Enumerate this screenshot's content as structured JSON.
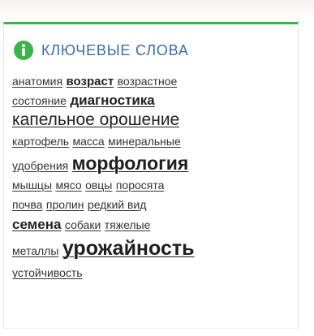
{
  "widget": {
    "title": "КЛЮЧЕВЫЕ СЛОВА",
    "icon": "info-icon",
    "accent_color": "#3bb44a",
    "title_color": "#3b6ea5"
  },
  "tags": [
    {
      "text": "анатомия"
    },
    {
      "text": "возраст"
    },
    {
      "text": "возрастное"
    },
    {
      "text": "состояние"
    },
    {
      "text": "диагностика"
    },
    {
      "text": "капельное орошение"
    },
    {
      "text": "картофель"
    },
    {
      "text": "масса"
    },
    {
      "text": "минеральные"
    },
    {
      "text": "удобрения"
    },
    {
      "text": "морфология"
    },
    {
      "text": "мышцы"
    },
    {
      "text": "мясо"
    },
    {
      "text": "овцы"
    },
    {
      "text": "поросята"
    },
    {
      "text": "почва"
    },
    {
      "text": "пролин"
    },
    {
      "text": "редкий вид"
    },
    {
      "text": "семена"
    },
    {
      "text": "собаки"
    },
    {
      "text": "тяжелые"
    },
    {
      "text": "металлы"
    },
    {
      "text": "урожайность"
    },
    {
      "text": "устойчивость"
    }
  ]
}
